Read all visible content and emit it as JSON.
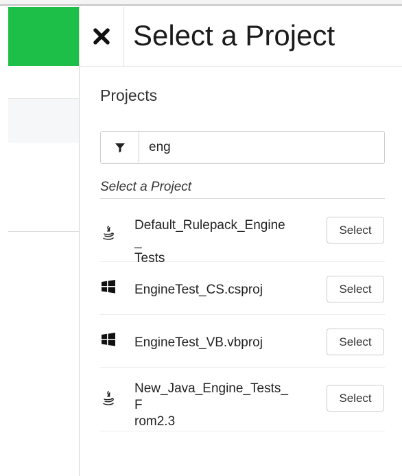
{
  "panel": {
    "title": "Select a Project",
    "close_icon": "close-icon"
  },
  "projects_section": {
    "label": "Projects",
    "filter": {
      "icon": "filter-icon",
      "value": "eng"
    },
    "list_caption": "Select a Project"
  },
  "projects": [
    {
      "name": "Default_Rulepack_Engine_Tests",
      "name_lines": [
        "Default_Rulepack_Engine_",
        "Tests"
      ],
      "icon": "java-icon",
      "action_label": "Select"
    },
    {
      "name": "EngineTest_CS.csproj",
      "name_lines": [
        "EngineTest_CS.csproj"
      ],
      "icon": "windows-icon",
      "action_label": "Select"
    },
    {
      "name": "EngineTest_VB.vbproj",
      "name_lines": [
        "EngineTest_VB.vbproj"
      ],
      "icon": "windows-icon",
      "action_label": "Select"
    },
    {
      "name": "New_Java_Engine_Tests_From2.3",
      "name_lines": [
        "New_Java_Engine_Tests_F",
        "rom2.3"
      ],
      "icon": "java-icon",
      "action_label": "Select"
    }
  ],
  "colors": {
    "accent_green": "#1ebf48"
  }
}
